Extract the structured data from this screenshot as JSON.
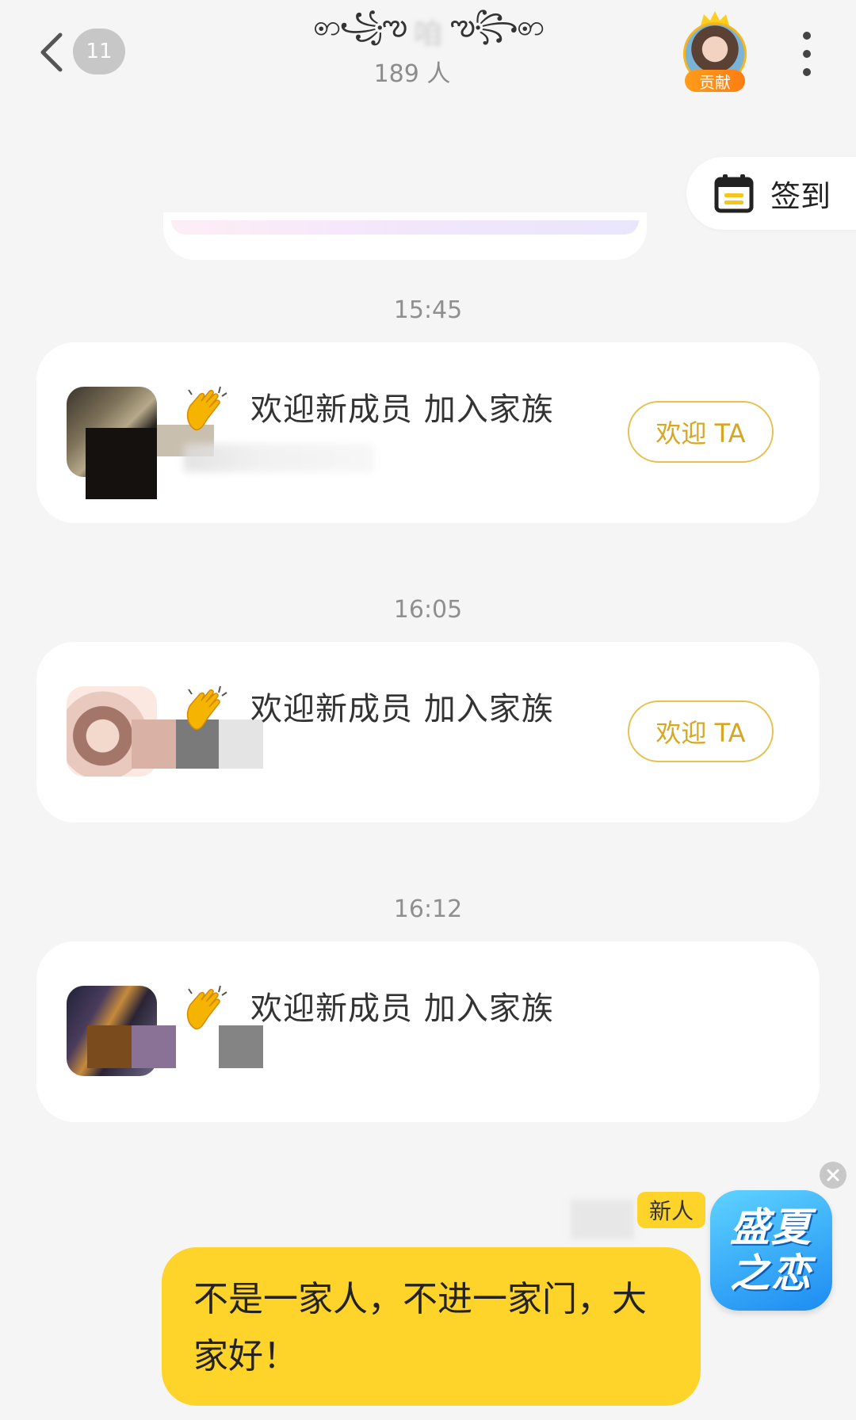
{
  "header": {
    "unread_count": "11",
    "title_left_ornament": "ꩦ꧁ఌ",
    "title_text": "咱",
    "title_right_ornament": "ఌ꧂ꩦ",
    "member_count": "189 人",
    "contributor_tag": "贡献"
  },
  "checkin": {
    "label": "签到"
  },
  "messages": [
    {
      "time": "15:45",
      "text": "欢迎新成员 加入家族",
      "button": "欢迎 TA"
    },
    {
      "time": "16:05",
      "text": "欢迎新成员 加入家族",
      "button": "欢迎 TA"
    },
    {
      "time": "16:12",
      "text": "欢迎新成员 加入家族"
    }
  ],
  "new_member": {
    "tag": "新人",
    "message": "不是一家人，不进一家门，大家好！"
  },
  "promo": {
    "line1": "盛夏",
    "line2": "之恋"
  },
  "colors": {
    "accent_yellow": "#fed32a",
    "button_gold": "#d6a722",
    "background": "#f5f5f5"
  }
}
